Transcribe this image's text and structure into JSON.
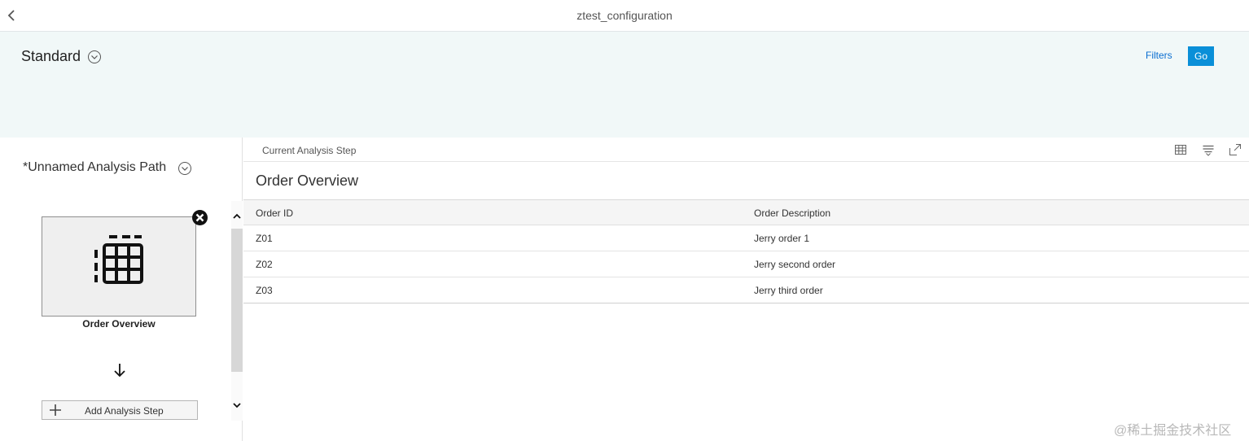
{
  "shell": {
    "title": "ztest_configuration"
  },
  "header": {
    "variant_title": "Standard",
    "filters_label": "Filters",
    "go_label": "Go"
  },
  "analysis_path": {
    "title": "*Unnamed Analysis Path",
    "steps": [
      {
        "label": "Order Overview",
        "icon": "table-icon"
      }
    ],
    "add_step_label": "Add Analysis Step"
  },
  "current_step": {
    "toolbar_label": "Current Analysis Step",
    "title": "Order Overview",
    "toolbar_icons": [
      "table-view-icon",
      "list-view-icon",
      "fullscreen-icon"
    ],
    "columns": [
      "Order ID",
      "Order Description"
    ],
    "rows": [
      [
        "Z01",
        "Jerry order 1"
      ],
      [
        "Z02",
        "Jerry second order"
      ],
      [
        "Z03",
        "Jerry third order"
      ]
    ]
  },
  "watermark": "@稀土掘金技术社区",
  "colors": {
    "accent": "#0a8fd8",
    "header_bg": "#f1f8f8"
  }
}
